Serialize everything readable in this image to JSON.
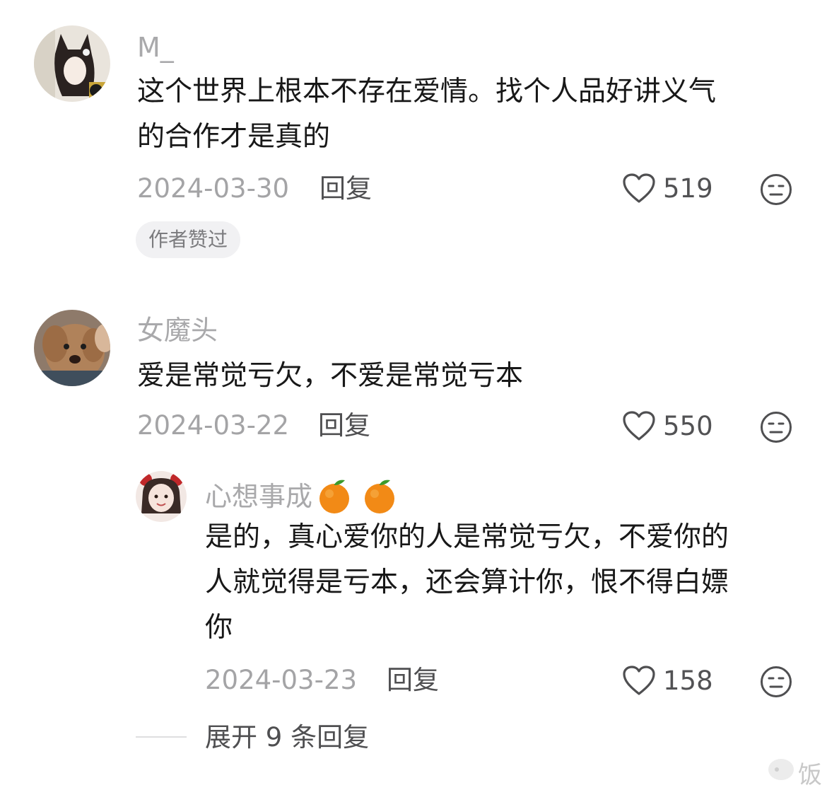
{
  "comments": [
    {
      "username": "M_",
      "text_lines": [
        "这个世界上根本不存在爱情。找个人品好讲义气",
        "的合作才是真的"
      ],
      "date": "2024-03-30",
      "reply_label": "回复",
      "likes": "519",
      "badge": "作者赞过"
    },
    {
      "username": "女魔头",
      "text_lines": [
        "爱是常觉亏欠，不爱是常觉亏本"
      ],
      "date": "2024-03-22",
      "reply_label": "回复",
      "likes": "550"
    }
  ],
  "reply": {
    "username": "心想事成",
    "text_lines": [
      "是的，真心爱你的人是常觉亏欠，不爱你的",
      "人就觉得是亏本，还会算计你，恨不得白嫖",
      "你"
    ],
    "date": "2024-03-23",
    "reply_label": "回复",
    "likes": "158",
    "emojis": [
      "tangerine-emoji",
      "tangerine-emoji"
    ]
  },
  "expand": {
    "label": "展开 9 条回复"
  },
  "watermark": "饭",
  "colors": {
    "text": "#181818",
    "muted": "#a9a9ab",
    "badge_bg": "#f1f1f3"
  }
}
